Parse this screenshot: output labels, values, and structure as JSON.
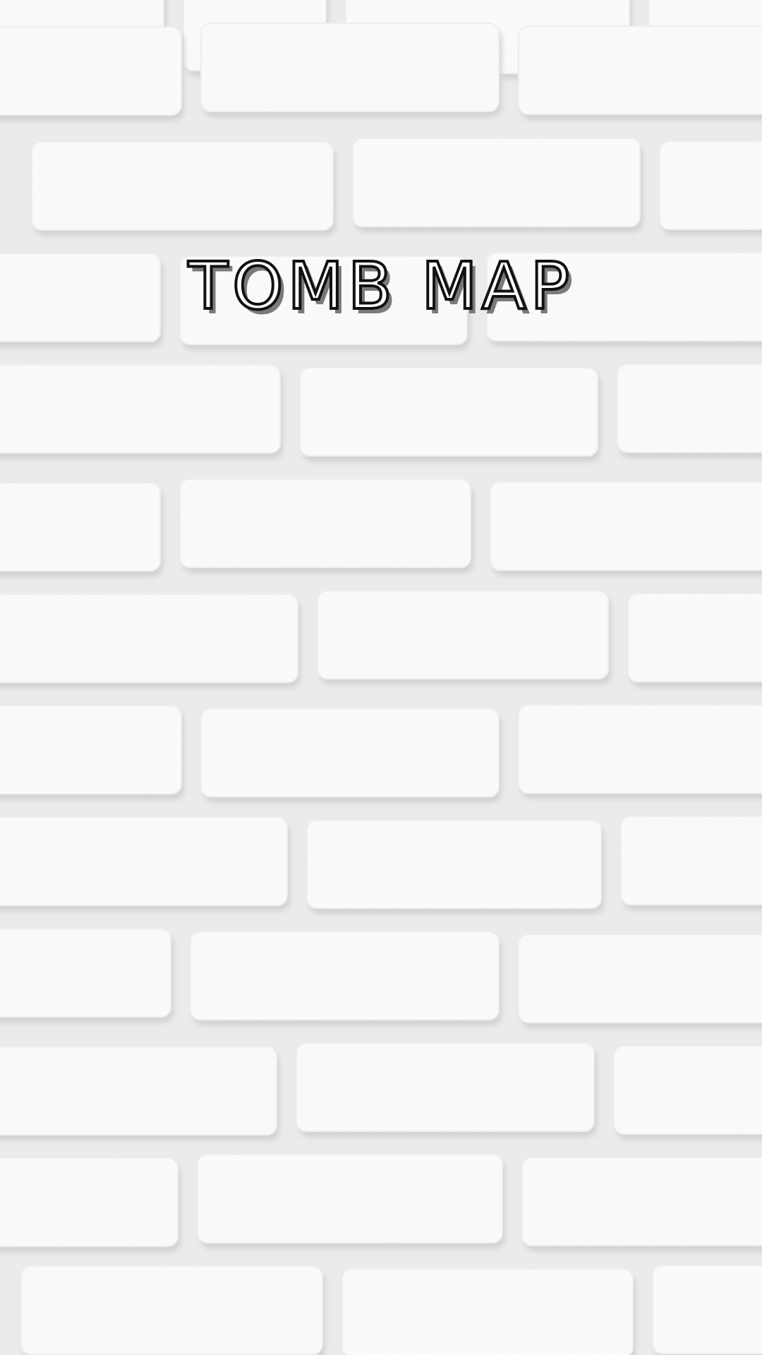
{
  "title": "TOMB MAP",
  "colors": {
    "wall": "#f6f6f6",
    "mortar": "#e6e6e6",
    "brick": "#fbfbfb",
    "title_outline": "#111111",
    "title_shadow": "#7a7a7a"
  }
}
